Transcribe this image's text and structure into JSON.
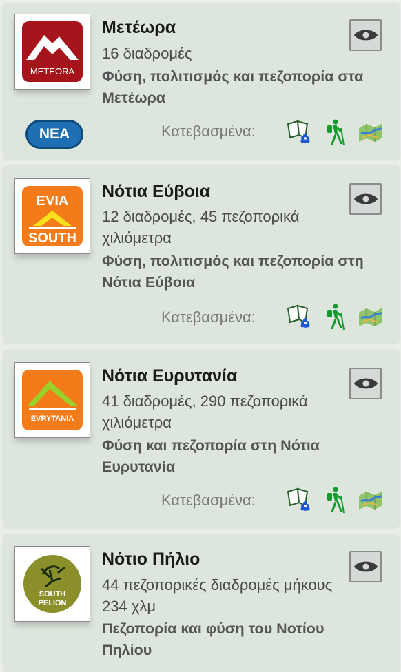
{
  "downloads_label": "Κατεβασμένα:",
  "cards": [
    {
      "title": "Μετέωρα",
      "meta": "16 διαδρομές",
      "description": "Φύση, πολιτισμός και πεζοπορία στα Μετέωρα",
      "logo_text": [
        "METEORA"
      ],
      "badge": "ΝΕΑ"
    },
    {
      "title": "Νότια Εύβοια",
      "meta": "12 διαδρομές, 45 πεζοπορικά χιλιόμετρα",
      "description": "Φύση, πολιτισμός και πεζοπορία στη Νότια Εύβοια",
      "logo_text": [
        "EVIA",
        "SOUTH"
      ]
    },
    {
      "title": "Νότια Ευρυτανία",
      "meta": "41 διαδρομές, 290 πεζοπορικά χιλιόμετρα",
      "description": "Φύση και πεζοπορία στη Νότια Ευρυτανία",
      "logo_text": [
        "EVRYTANIA"
      ]
    },
    {
      "title": "Νότιο Πήλιο",
      "meta": "44 πεζοπορικές διαδρομές μήκους 234 χλμ",
      "description": "Πεζοπορία και φύση του Νοτίου Πηλίου",
      "logo_text": [
        "SOUTH",
        "PELION"
      ]
    }
  ],
  "icons": {
    "view": "eye-icon",
    "guide": "book-flower-icon",
    "hike": "hiker-icon",
    "map": "map-icon"
  },
  "colors": {
    "card_bg": "#dde6dc",
    "badge_bg": "#1e6fb3",
    "meteora_red": "#a5141b",
    "evia_orange": "#f47b1a",
    "evrytania_orange": "#f47b1a",
    "pelion_olive": "#8b8f2a"
  }
}
